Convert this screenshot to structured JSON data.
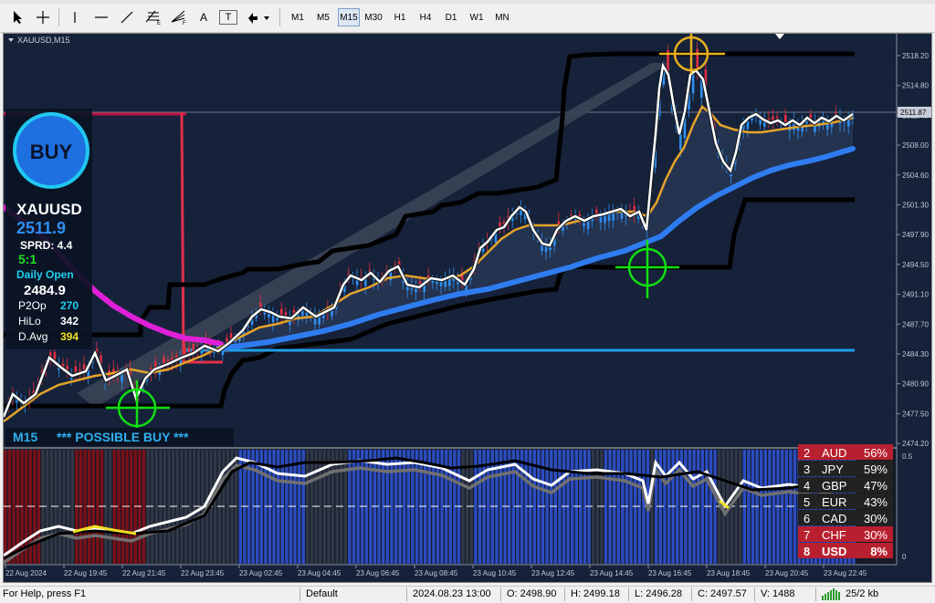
{
  "toolbar": {
    "timeframes": [
      {
        "label": "M1",
        "active": false
      },
      {
        "label": "M5",
        "active": false
      },
      {
        "label": "M15",
        "active": true
      },
      {
        "label": "M30",
        "active": false
      },
      {
        "label": "H1",
        "active": false
      },
      {
        "label": "H4",
        "active": false
      },
      {
        "label": "D1",
        "active": false
      },
      {
        "label": "W1",
        "active": false
      },
      {
        "label": "MN",
        "active": false
      }
    ],
    "text_tool": "A",
    "label_tool": "T"
  },
  "chart": {
    "title": "XAUUSD,M15",
    "price_axis": [
      "2518.20",
      "2514.80",
      "2511.45",
      "2508.00",
      "2504.60",
      "2501.30",
      "2497.90",
      "2494.50",
      "2491.10",
      "2487.70",
      "2484.30",
      "2480.90",
      "2477.50",
      "2474.20"
    ],
    "current_price_label": "2511.87",
    "time_axis": [
      "22 Aug 2024",
      "22 Aug 19:45",
      "22 Aug 21:45",
      "22 Aug 23:45",
      "23 Aug 02:45",
      "23 Aug 04:45",
      "23 Aug 06:45",
      "23 Aug 08:45",
      "23 Aug 10:45",
      "23 Aug 12:45",
      "23 Aug 14:45",
      "23 Aug 16:45",
      "23 Aug 18:45",
      "23 Aug 20:45",
      "23 Aug 22:45"
    ],
    "sub_axis": [
      "0.5",
      "0"
    ]
  },
  "panel": {
    "buy_label": "BUY",
    "symbol": "XAUUSD",
    "price": "2511.9",
    "spread_text": "SPRD: 4.4",
    "ratio": "5:1",
    "daily_open_label": "Daily Open",
    "daily_open_value": "2484.9",
    "rows": [
      {
        "label": "P2Op",
        "value": "270"
      },
      {
        "label": "HiLo",
        "value": "342"
      },
      {
        "label": "D.Avg",
        "value": "394"
      }
    ],
    "tf_label": "M15",
    "signal_text": "*** POSSIBLE BUY ***"
  },
  "strength": [
    {
      "rank": "2",
      "currency": "AUD",
      "pct": "56%",
      "bg": "#b8202f"
    },
    {
      "rank": "3",
      "currency": "JPY",
      "pct": "59%",
      "bg": "#222222"
    },
    {
      "rank": "4",
      "currency": "GBP",
      "pct": "47%",
      "bg": "#222222"
    },
    {
      "rank": "5",
      "currency": "EUR",
      "pct": "43%",
      "bg": "#222222"
    },
    {
      "rank": "6",
      "currency": "CAD",
      "pct": "30%",
      "bg": "#222222"
    },
    {
      "rank": "7",
      "currency": "CHF",
      "pct": "30%",
      "bg": "#b8202f"
    },
    {
      "rank": "8",
      "currency": "USD",
      "pct": "8%",
      "bg": "#b8202f"
    }
  ],
  "colors": {
    "chart_bg": "#16223a",
    "bull": "#2f8ff0",
    "bear": "#e03040",
    "fast_ma": "#ffffff",
    "mid_ma": "#e5a32a",
    "slow_ma": "#2f7cf0",
    "channel": "#000000",
    "buy_circle": "#1e90ff"
  },
  "status": {
    "help": "For Help, press F1",
    "profile": "Default",
    "datetime": "2024.08.23 13:00",
    "open": "O: 2498.90",
    "high": "H: 2499.18",
    "low": "L: 2496.28",
    "close": "C: 2497.57",
    "volume": "V: 1488",
    "traffic": "25/2 kb"
  }
}
